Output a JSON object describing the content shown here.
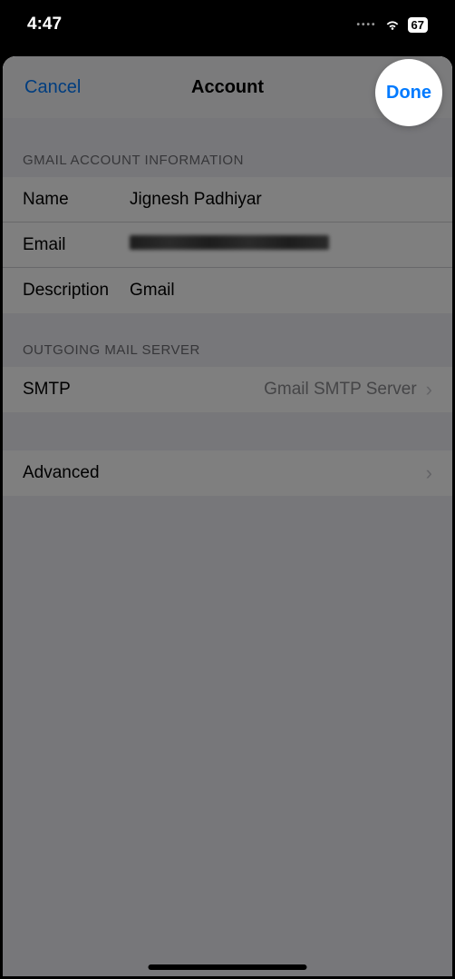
{
  "statusBar": {
    "time": "4:47",
    "battery": "67"
  },
  "nav": {
    "cancel": "Cancel",
    "title": "Account",
    "done": "Done"
  },
  "sections": {
    "accountInfo": {
      "header": "GMAIL ACCOUNT INFORMATION",
      "rows": {
        "name": {
          "label": "Name",
          "value": "Jignesh Padhiyar"
        },
        "email": {
          "label": "Email",
          "value": ""
        },
        "description": {
          "label": "Description",
          "value": "Gmail"
        }
      }
    },
    "outgoing": {
      "header": "OUTGOING MAIL SERVER",
      "smtp": {
        "label": "SMTP",
        "value": "Gmail SMTP Server"
      }
    },
    "advanced": {
      "label": "Advanced"
    }
  },
  "highlight": {
    "done": "Done"
  }
}
